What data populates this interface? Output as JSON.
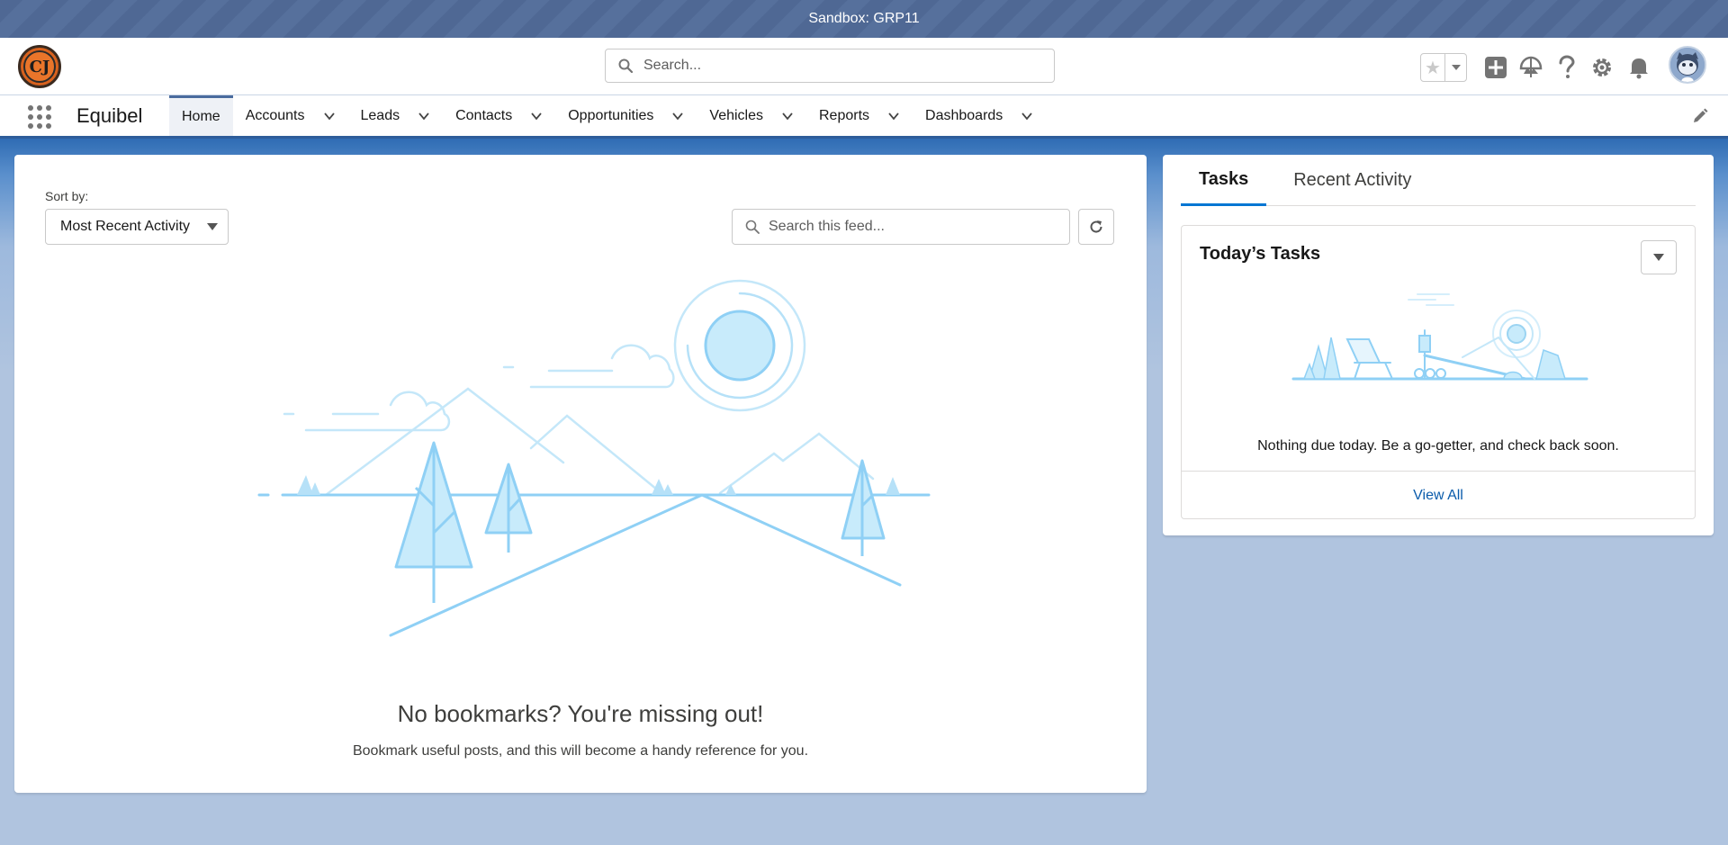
{
  "sandbox": {
    "label": "Sandbox: GRP11"
  },
  "header": {
    "org_logo_text": "CJ",
    "search_placeholder": "Search..."
  },
  "nav": {
    "app_name": "Equibel",
    "items": [
      {
        "label": "Home",
        "active": true,
        "has_menu": false
      },
      {
        "label": "Accounts",
        "has_menu": true
      },
      {
        "label": "Leads",
        "has_menu": true
      },
      {
        "label": "Contacts",
        "has_menu": true
      },
      {
        "label": "Opportunities",
        "has_menu": true
      },
      {
        "label": "Vehicles",
        "has_menu": true
      },
      {
        "label": "Reports",
        "has_menu": true
      },
      {
        "label": "Dashboards",
        "has_menu": true
      }
    ]
  },
  "feed": {
    "sort_label": "Sort by:",
    "sort_value": "Most Recent Activity",
    "search_placeholder": "Search this feed...",
    "empty_title": "No bookmarks? You're missing out!",
    "empty_subtitle": "Bookmark useful posts, and this will become a handy reference for you."
  },
  "tasks": {
    "tabs": [
      {
        "label": "Tasks",
        "active": true
      },
      {
        "label": "Recent Activity",
        "active": false
      }
    ],
    "card_title": "Today’s Tasks",
    "empty_message": "Nothing due today. Be a go-getter, and check back soon.",
    "view_all": "View All"
  },
  "colors": {
    "brand_blue": "#0176d3",
    "sandbox_bar": "#4f6894",
    "illustration": "#8fd0f5"
  }
}
